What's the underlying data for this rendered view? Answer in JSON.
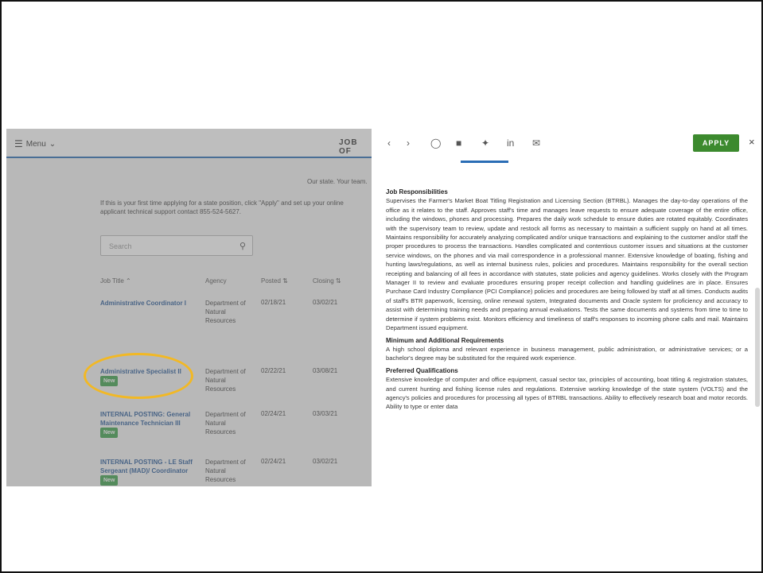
{
  "header": {
    "menu_label": "Menu",
    "page_title": "JOB OF"
  },
  "intro": {
    "our_state": "Our state. Your team.",
    "line1": "If this is your first time applying for a state position, click \"Apply\" and set up your online",
    "line2": "applicant technical support contact 855-524-5627."
  },
  "search": {
    "placeholder": "Search"
  },
  "table": {
    "headers": [
      "Job Title",
      "Agency",
      "Posted",
      "Closing"
    ],
    "rows": [
      {
        "title": "Administrative Coordinator I",
        "badge": "",
        "agency": "Department of Natural Resources",
        "posted": "02/18/21",
        "closing": "03/02/21"
      },
      {
        "title": "Administrative Specialist II",
        "badge": "New",
        "agency": "Department of Natural Resources",
        "posted": "02/22/21",
        "closing": "03/08/21"
      },
      {
        "title": "INTERNAL POSTING: General Maintenance Technician III",
        "badge": "New",
        "agency": "Department of Natural Resources",
        "posted": "02/24/21",
        "closing": "03/03/21"
      },
      {
        "title": "INTERNAL POSTING - LE Staff Sergeant (MAD)/ Coordinator",
        "badge": "New",
        "agency": "Department of Natural Resources",
        "posted": "02/24/21",
        "closing": "03/02/21"
      }
    ]
  },
  "detail": {
    "apply_label": "APPLY",
    "close_label": "×",
    "sections": [
      {
        "heading": "Job Responsibilities",
        "body": "Supervises the Farmer's Market Boat Titling Registration and Licensing Section (BTRBL). Manages the day-to-day operations of the office as it relates to the staff. Approves staff's time and manages leave requests to ensure adequate coverage of the entire office, including the windows, phones and processing. Prepares the daily work schedule to ensure duties are rotated equitably. Coordinates with the supervisory team to review, update and restock all forms as necessary to maintain a sufficient supply on hand at all times. Maintains responsibility for accurately analyzing complicated and/or unique transactions and explaining to the customer and/or staff the proper procedures to process the transactions. Handles complicated and contentious customer issues and situations at the customer service windows, on the phones and via mail correspondence in a professional manner. Extensive knowledge of boating, fishing and hunting laws/regulations, as well as internal business rules, policies and procedures. Maintains responsibility for the overall section receipting and balancing of all fees in accordance with statutes, state policies and agency guidelines. Works closely with the Program Manager II to review and evaluate procedures ensuring proper receipt collection and handling guidelines are in place. Ensures Purchase Card Industry Compliance (PCI Compliance) policies and procedures are being followed by staff at all times. Conducts audits of staff's BTR paperwork, licensing, online renewal system, Integrated documents and Oracle system for proficiency and accuracy to assist with determining training needs and preparing annual evaluations. Tests the same documents and systems from time to time to determine if system problems exist. Monitors efficiency and timeliness of staff's responses to incoming phone calls and mail. Maintains Department issued equipment."
      },
      {
        "heading": "Minimum and Additional Requirements",
        "body": "A high school diploma and relevant experience in business management, public administration, or administrative services; or a bachelor's degree may be substituted for the required work experience."
      },
      {
        "heading": "Preferred Qualifications",
        "body": "Extensive knowledge of computer and office equipment, casual sector tax, principles of accounting, boat titling & registration statutes, and current hunting and fishing license rules and regulations. Extensive working knowledge of the state system (VOLTS) and the agency's policies and procedures for processing all types of BTRBL transactions. Ability to effectively research boat and motor records. Ability to type or enter data"
      }
    ]
  },
  "colors": {
    "accent_blue": "#2a6db5",
    "apply_green": "#3c8a2e",
    "badge_green": "#3fa34d",
    "highlight_circle": "#f2b824"
  }
}
